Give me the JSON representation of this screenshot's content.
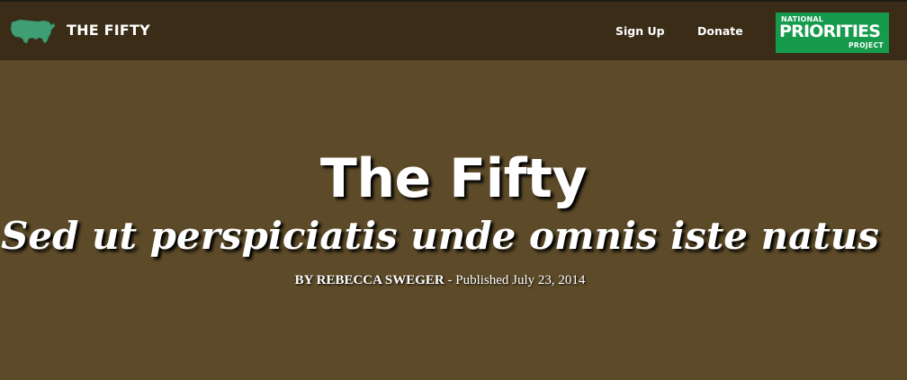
{
  "header": {
    "brand": "THE FIFTY",
    "nav": {
      "signup": "Sign Up",
      "donate": "Donate"
    },
    "logo": {
      "line1": "NATIONAL",
      "line2": "PRIORITIES",
      "line3": "PROJECT"
    },
    "logo_icon": "us-map-icon"
  },
  "hero": {
    "title": "The Fifty",
    "subtitle": "Sed ut perspiciatis unde omnis iste natus",
    "byline": {
      "author": "BY REBECCA SWEGER",
      "separator": " - ",
      "published": "Published July 23, 2014"
    }
  },
  "colors": {
    "topbar": "#3a2c17",
    "hero_background": "#5c4a28",
    "logo_green": "#169a4c",
    "map_green": "#3f9e74"
  }
}
